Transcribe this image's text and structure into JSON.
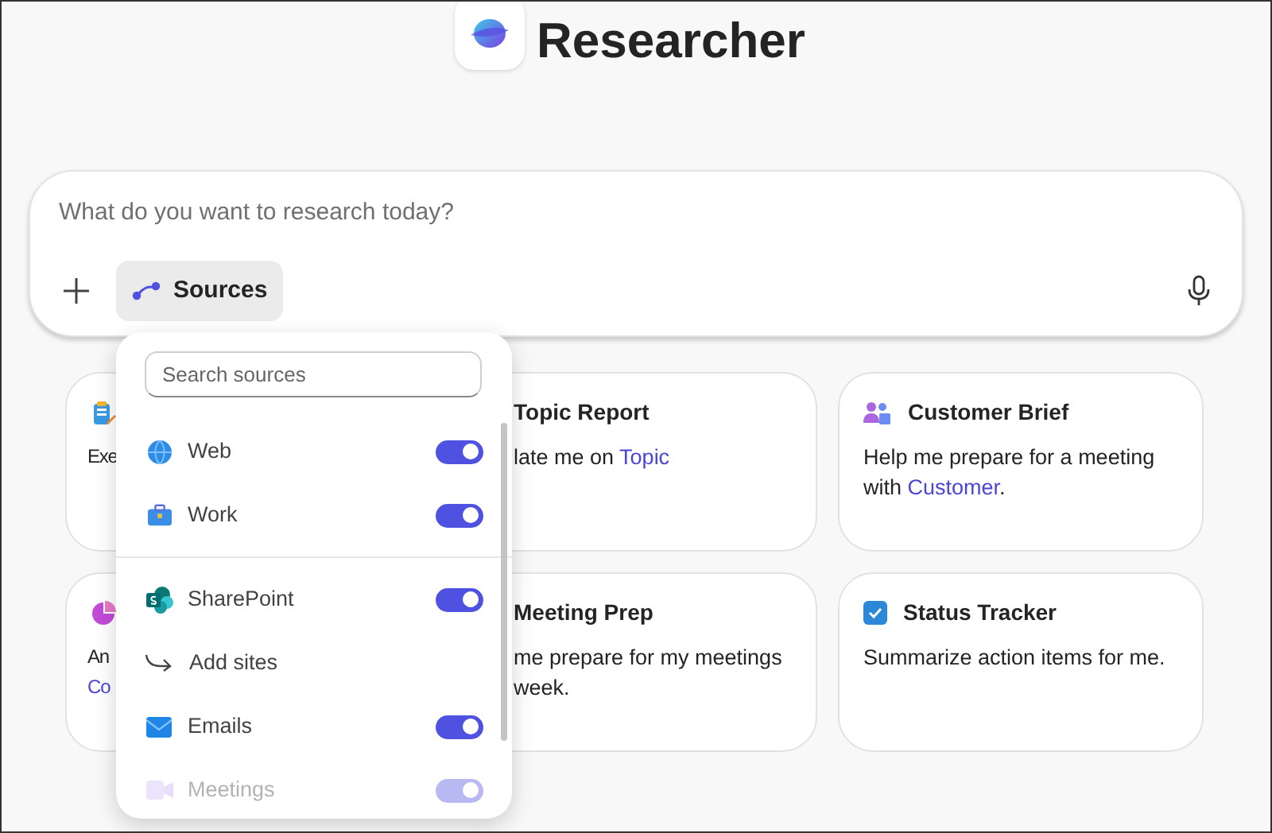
{
  "header": {
    "title": "Researcher"
  },
  "composer": {
    "placeholder": "What do you want to research today?",
    "sources_button": "Sources"
  },
  "cards": [
    {
      "lines": [
        [
          {
            "text": "Exe",
            "link": false
          }
        ]
      ]
    },
    {
      "title": "Topic Report",
      "lines": [
        [
          {
            "text": "late me on ",
            "link": false
          },
          {
            "text": "Topic",
            "link": true
          }
        ]
      ]
    },
    {
      "title": "Customer Brief",
      "lines": [
        [
          {
            "text": "Help me prepare for a meeting",
            "link": false
          }
        ],
        [
          {
            "text": "with ",
            "link": false
          },
          {
            "text": "Customer",
            "link": true
          },
          {
            "text": ".",
            "link": false
          }
        ]
      ]
    },
    {
      "lines": [
        [
          {
            "text": "An",
            "link": false
          }
        ],
        [
          {
            "text": "Co",
            "link": true
          }
        ]
      ]
    },
    {
      "title": "Meeting Prep",
      "lines": [
        [
          {
            "text": "me prepare for my meetings",
            "link": false
          }
        ],
        [
          {
            "text": "week.",
            "link": false
          }
        ]
      ]
    },
    {
      "title": "Status Tracker",
      "lines": [
        [
          {
            "text": "Summarize action items for me.",
            "link": false
          }
        ]
      ]
    }
  ],
  "sources_menu": {
    "search_placeholder": "Search sources",
    "items": [
      {
        "kind": "toggle",
        "label": "Web",
        "on": true,
        "disabled": false
      },
      {
        "kind": "toggle",
        "label": "Work",
        "on": true,
        "disabled": false
      },
      {
        "kind": "divider"
      },
      {
        "kind": "toggle",
        "label": "SharePoint",
        "on": true,
        "disabled": false
      },
      {
        "kind": "action",
        "label": "Add sites"
      },
      {
        "kind": "toggle",
        "label": "Emails",
        "on": true,
        "disabled": false
      },
      {
        "kind": "toggle",
        "label": "Meetings",
        "on": true,
        "disabled": true
      }
    ]
  }
}
